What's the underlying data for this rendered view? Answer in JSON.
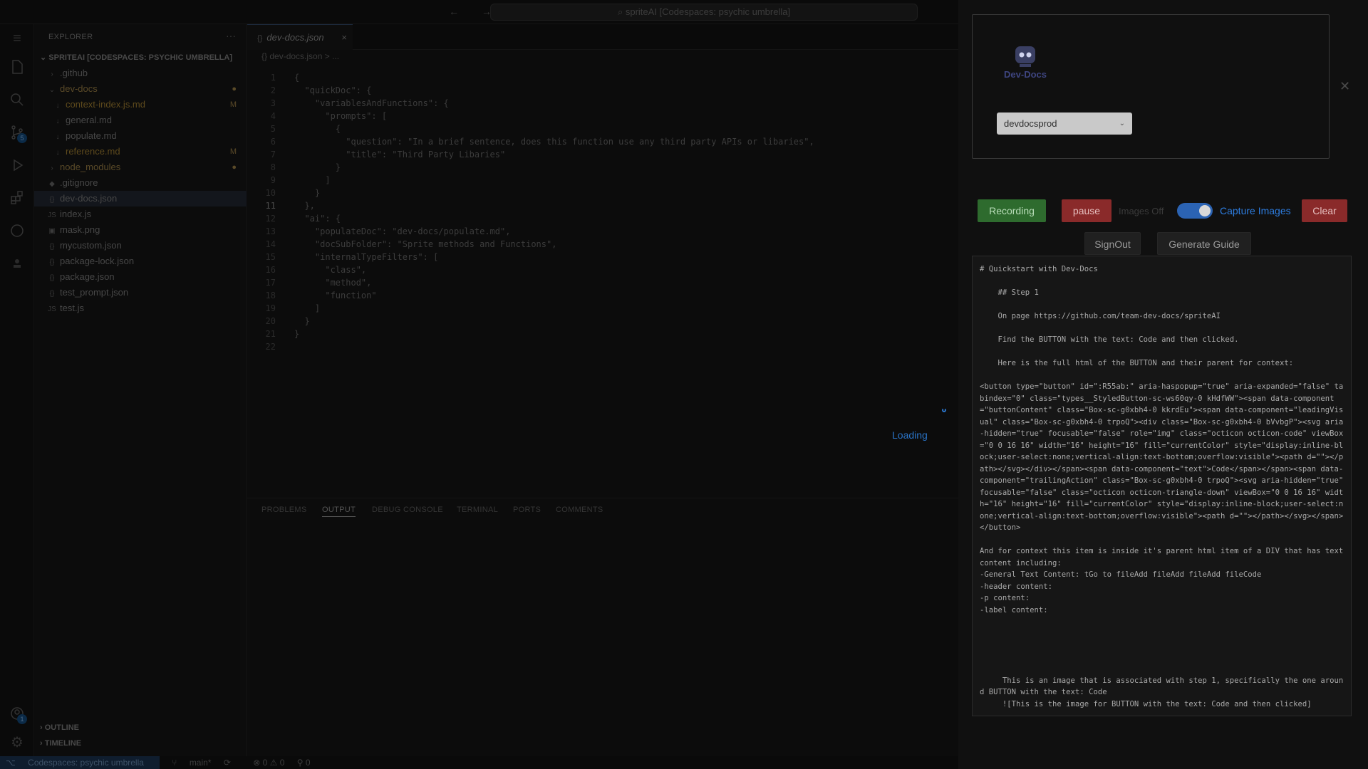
{
  "window": {
    "title": "spriteAI [Codespaces: psychic umbrella]"
  },
  "sidebar": {
    "title": "EXPLORER",
    "workspace": "SPRITEAI [CODESPACES: PSYCHIC UMBRELLA]",
    "items": [
      {
        "label": ".github",
        "kind": "folder"
      },
      {
        "label": "dev-docs",
        "kind": "folder-open"
      },
      {
        "label": "context-index.js.md",
        "kind": "md",
        "badge": "M"
      },
      {
        "label": "general.md",
        "kind": "md"
      },
      {
        "label": "populate.md",
        "kind": "md"
      },
      {
        "label": "reference.md",
        "kind": "md",
        "badge": "M"
      },
      {
        "label": "node_modules",
        "kind": "folder"
      },
      {
        "label": ".gitignore",
        "kind": "file"
      },
      {
        "label": "dev-docs.json",
        "kind": "json"
      },
      {
        "label": "index.js",
        "kind": "js"
      },
      {
        "label": "mask.png",
        "kind": "img"
      },
      {
        "label": "mycustom.json",
        "kind": "json"
      },
      {
        "label": "package-lock.json",
        "kind": "json"
      },
      {
        "label": "package.json",
        "kind": "json"
      },
      {
        "label": "test_prompt.json",
        "kind": "json"
      },
      {
        "label": "test.js",
        "kind": "js"
      }
    ],
    "outline": "OUTLINE",
    "timeline": "TIMELINE"
  },
  "editor": {
    "tab_label": "dev-docs.json",
    "breadcrumb": "{} dev-docs.json > ...",
    "lines": [
      "{",
      "  \"quickDoc\": {",
      "    \"variablesAndFunctions\": {",
      "      \"prompts\": [",
      "        {",
      "          \"question\": \"In a brief sentence, does this function use any third party APIs or libaries\",",
      "          \"title\": \"Third Party Libaries\"",
      "        }",
      "      ]",
      "    }",
      "  },",
      "  \"ai\": {",
      "    \"populateDoc\": \"dev-docs/populate.md\",",
      "    \"docSubFolder\": \"Sprite methods and Functions\",",
      "    \"internalTypeFilters\": [",
      "      \"class\",",
      "      \"method\",",
      "      \"function\"",
      "    ]",
      "  }",
      "}",
      ""
    ],
    "loading_text": "Loading"
  },
  "panel": {
    "tabs": [
      "PROBLEMS",
      "OUTPUT",
      "DEBUG CONSOLE",
      "TERMINAL",
      "PORTS",
      "COMMENTS"
    ]
  },
  "statusbar": {
    "remote": "Codespaces: psychic umbrella",
    "branch": "main*",
    "problems": "⊗ 0 ⚠ 0",
    "ports": "⚲ 0"
  },
  "extension": {
    "logo_text": "Dev-Docs",
    "env_value": "devdocsprod",
    "recording": "Recording",
    "pause": "pause",
    "images_off": "Images Off",
    "capture_images": "Capture Images",
    "clear": "Clear",
    "signout": "SignOut",
    "generate_guide": "Generate Guide",
    "guide_text": "# Quickstart with Dev-Docs\n\n    ## Step 1\n\n    On page https://github.com/team-dev-docs/spriteAI\n\n    Find the BUTTON with the text: Code and then clicked.\n\n    Here is the full html of the BUTTON and their parent for context:\n\n<button type=\"button\" id=\":R55ab:\" aria-haspopup=\"true\" aria-expanded=\"false\" tabindex=\"0\" class=\"types__StyledButton-sc-ws60qy-0 kHdfWW\"><span data-component=\"buttonContent\" class=\"Box-sc-g0xbh4-0 kkrdEu\"><span data-component=\"leadingVisual\" class=\"Box-sc-g0xbh4-0 trpoQ\"><div class=\"Box-sc-g0xbh4-0 bVvbgP\"><svg aria-hidden=\"true\" focusable=\"false\" role=\"img\" class=\"octicon octicon-code\" viewBox=\"0 0 16 16\" width=\"16\" height=\"16\" fill=\"currentColor\" style=\"display:inline-block;user-select:none;vertical-align:text-bottom;overflow:visible\"><path d=\"\"></path></svg></div></span><span data-component=\"text\">Code</span></span><span data-component=\"trailingAction\" class=\"Box-sc-g0xbh4-0 trpoQ\"><svg aria-hidden=\"true\" focusable=\"false\" class=\"octicon octicon-triangle-down\" viewBox=\"0 0 16 16\" width=\"16\" height=\"16\" fill=\"currentColor\" style=\"display:inline-block;user-select:none;vertical-align:text-bottom;overflow:visible\"><path d=\"\"></path></svg></span></button>\n\nAnd for context this item is inside it's parent html item of a DIV that has text content including:\n-General Text Content: tGo to fileAdd fileAdd fileAdd fileCode\n-header content:\n-p content:\n-label content:\n\n\n\n\n\n     This is an image that is associated with step 1, specifically the one around BUTTON with the text: Code\n     ![This is the image for BUTTON with the text: Code and then clicked]"
  },
  "colors": {
    "accent": "#2d7de0",
    "record": "#2e6b2e",
    "danger": "#8a2a2a"
  }
}
